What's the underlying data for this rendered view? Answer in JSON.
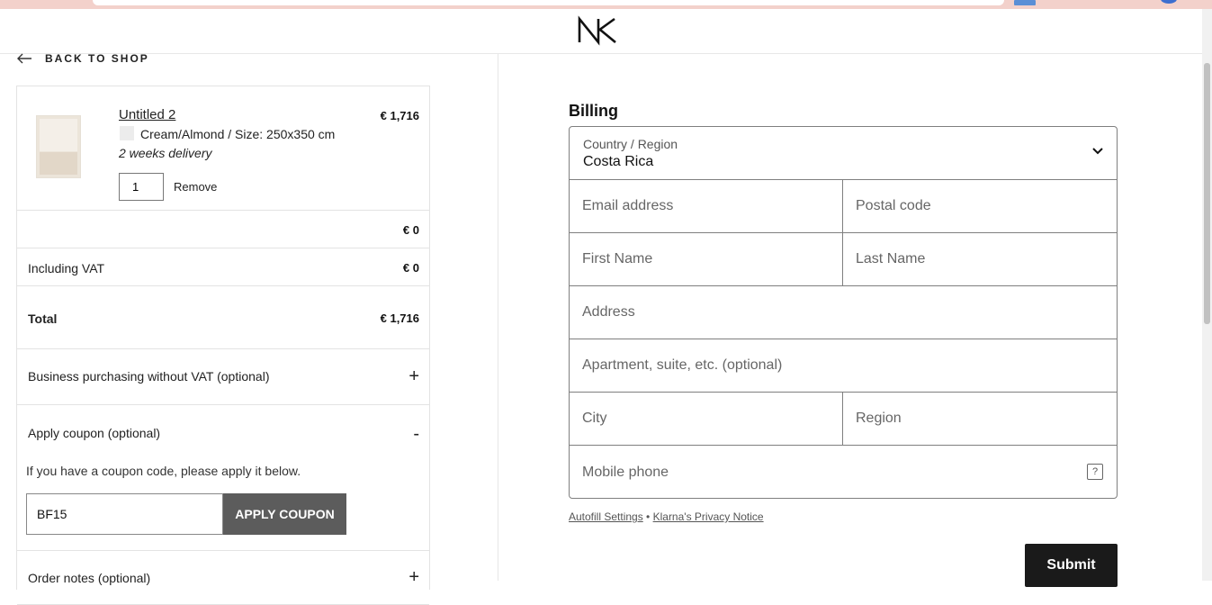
{
  "header": {
    "logo_text": "NK"
  },
  "nav": {
    "back_label": "BACK TO SHOP"
  },
  "cart": {
    "item": {
      "title": "Untitled 2",
      "price": "€ 1,716",
      "variant": "Cream/Almond / Size: 250x350 cm",
      "delivery": "2 weeks delivery",
      "quantity": "1",
      "remove_label": "Remove"
    },
    "shipping_value": "€ 0",
    "vat_label": "Including VAT",
    "vat_value": "€ 0",
    "total_label": "Total",
    "total_value": "€ 1,716",
    "business_label": "Business purchasing without VAT (optional)",
    "business_toggle": "+",
    "coupon_label": "Apply coupon (optional)",
    "coupon_toggle": "-",
    "coupon_help": "If you have a coupon code, please apply it below.",
    "coupon_value": "BF15",
    "coupon_button": "APPLY COUPON",
    "notes_label": "Order notes (optional)",
    "notes_toggle": "+"
  },
  "billing": {
    "title": "Billing",
    "country_caption": "Country / Region",
    "country_value": "Costa Rica",
    "email_placeholder": "Email address",
    "postal_placeholder": "Postal code",
    "first_name_placeholder": "First Name",
    "last_name_placeholder": "Last Name",
    "address_placeholder": "Address",
    "apartment_placeholder": "Apartment, suite, etc. (optional)",
    "city_placeholder": "City",
    "region_placeholder": "Region",
    "phone_placeholder": "Mobile phone",
    "help_glyph": "?",
    "autofill_link": "Autofill Settings",
    "separator": " • ",
    "privacy_link": "Klarna's Privacy Notice",
    "submit_label": "Submit"
  },
  "colors": {
    "accent": "#1a1a1a",
    "coupon_button": "#5c5c5c",
    "browser_bar": "#f3d1cb"
  }
}
